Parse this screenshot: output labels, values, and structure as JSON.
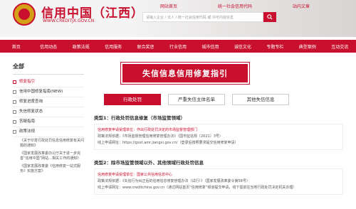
{
  "header": {
    "site_title": "信用中国（江西）",
    "site_url": "WWW.CREDITJX.GOV.CN",
    "top_links": [
      "网站首页",
      "统一社会信用代码",
      "站内文章"
    ],
    "search_placeholder": "请输入企业 / 法人 / 统一社会信用代码 或 许可内容信息"
  },
  "nav": {
    "items": [
      "首页",
      "信用动态",
      "政策法规",
      "信用服务",
      "联合奖惩",
      "行业信用",
      "城市信用",
      "诚信文化",
      "专题专栏",
      "典型案例",
      "互动交流"
    ]
  },
  "sidebar": {
    "title": "全部",
    "items": [
      {
        "label": "修复指引",
        "active": true
      },
      {
        "label": "信用中国修复指南(NEW)",
        "active": false
      },
      {
        "label": "修复进度查询",
        "active": false
      },
      {
        "label": "失信修复状态",
        "active": false
      },
      {
        "label": "答疑指南",
        "active": false
      },
      {
        "label": "政策法规",
        "active": false
      }
    ],
    "sub_items": [
      "《关于印发行政处罚信息信用修复有关问题的通知》",
      "《国家发展改革委办公厅关于进一步完善“信用中国”网站…相关工作的通知》",
      "《国家发展改革委《信用修复一站式服务》实施方案》"
    ]
  },
  "main": {
    "banner": "失信信息信用修复指引",
    "tabs": [
      "行政处罚",
      "严重失信主体名单",
      "其他失信信息"
    ],
    "sections": [
      {
        "title": "类型1：行政处罚信息修复（市场监管领域）",
        "lines": [
          {
            "text": "信用修复申请受理单位：作出行政处罚决定的市场监督管理部门",
            "red": true
          },
          {
            "text": "政策法规依据：《市场监督管理信用修复管理办法》（国市监信规〔2021〕3号）",
            "red": false
          },
          {
            "text": "线上申请网址：https://gsxt.amr.jiangxi.gov.cn/（登录后按照要求提交信用修复申请）",
            "red": false
          }
        ]
      },
      {
        "title": "类型2：除市场监管领域以外、其他领域行政处罚信息",
        "lines": [
          {
            "text": "信用修复申请受理单位：国家公共信用信息中心",
            "red": true
          },
          {
            "text": "政策法规依据：《失信行为纠正后的信用信息修复管理办法（试行）》（国家发展改革委令第58号）",
            "red": false
          },
          {
            "text": "线上申请网址：www.creditchina.gov.cn（通过网站首页“信用修复”频道提交申请，线下需前往当地行政处罚决定机关办理）",
            "red": false
          }
        ]
      }
    ]
  },
  "colors": {
    "brand": "#c8102e",
    "link": "#1a56c8"
  }
}
